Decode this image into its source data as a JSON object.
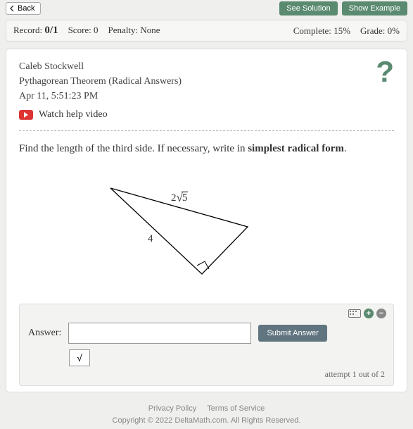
{
  "topbar": {
    "back": "Back",
    "see_solution": "See Solution",
    "show_example": "Show Example"
  },
  "status": {
    "record_label": "Record:",
    "record_value": "0/1",
    "score_label": "Score:",
    "score_value": "0",
    "penalty_label": "Penalty:",
    "penalty_value": "None",
    "complete_label": "Complete:",
    "complete_value": "15%",
    "grade_label": "Grade:",
    "grade_value": "0%"
  },
  "meta": {
    "student": "Caleb Stockwell",
    "assignment": "Pythagorean Theorem (Radical Answers)",
    "timestamp": "Apr 11, 5:51:23 PM",
    "watch": "Watch help video"
  },
  "help_glyph": "?",
  "problem": {
    "lead": "Find the length of the third side. If necessary, write in ",
    "bold": "simplest radical form",
    "tail": ".",
    "hyp_coeff": "2",
    "hyp_radicand": "5",
    "leg": "4"
  },
  "answer": {
    "label": "Answer:",
    "value": "",
    "submit": "Submit Answer",
    "sqrt_glyph": "√",
    "attempt": "attempt 1 out of 2",
    "plus": "+",
    "minus": "−"
  },
  "footer": {
    "privacy": "Privacy Policy",
    "terms": "Terms of Service",
    "copyright": "Copyright © 2022 DeltaMath.com. All Rights Reserved."
  }
}
